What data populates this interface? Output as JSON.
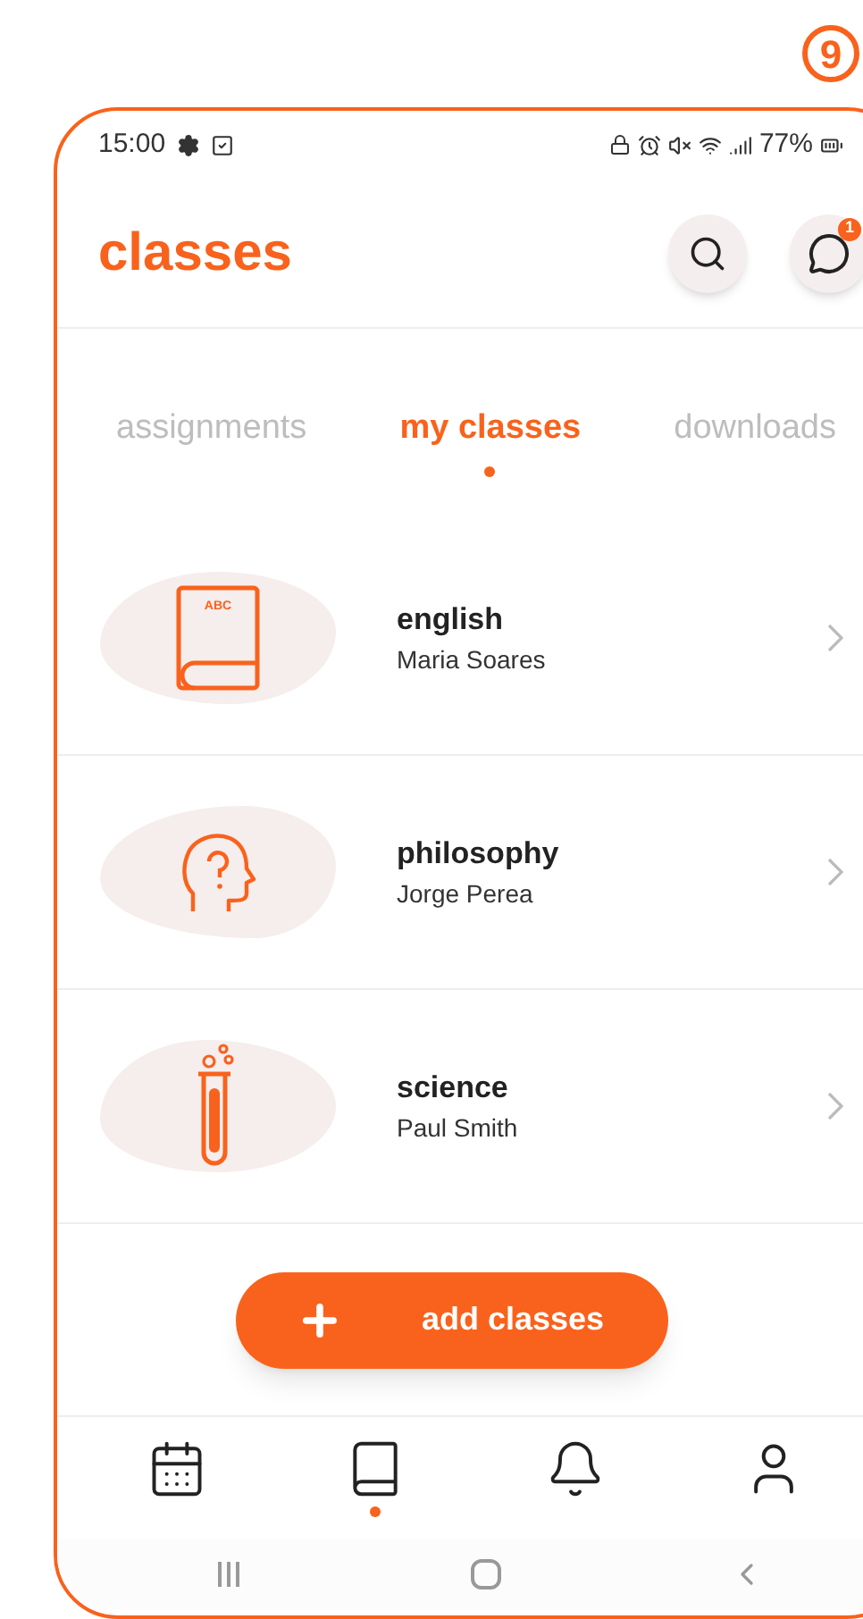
{
  "annotation": {
    "number": "9"
  },
  "status_bar": {
    "time": "15:00",
    "battery": "77%"
  },
  "header": {
    "title": "classes",
    "chat_badge": "1"
  },
  "tabs": [
    {
      "label": "assignments",
      "selected": false
    },
    {
      "label": "my classes",
      "selected": true
    },
    {
      "label": "downloads",
      "selected": false
    }
  ],
  "classes": [
    {
      "kind": "book",
      "name": "english",
      "teacher": "Maria Soares",
      "icon_text": "ABC"
    },
    {
      "kind": "head",
      "name": "philosophy",
      "teacher": "Jorge Perea"
    },
    {
      "kind": "flask",
      "name": "science",
      "teacher": "Paul Smith"
    }
  ],
  "add_button": {
    "label": "add classes"
  },
  "bottom_nav": [
    {
      "kind": "calendar",
      "selected": false
    },
    {
      "kind": "book",
      "selected": true
    },
    {
      "kind": "bell",
      "selected": false
    },
    {
      "kind": "user",
      "selected": false
    }
  ]
}
